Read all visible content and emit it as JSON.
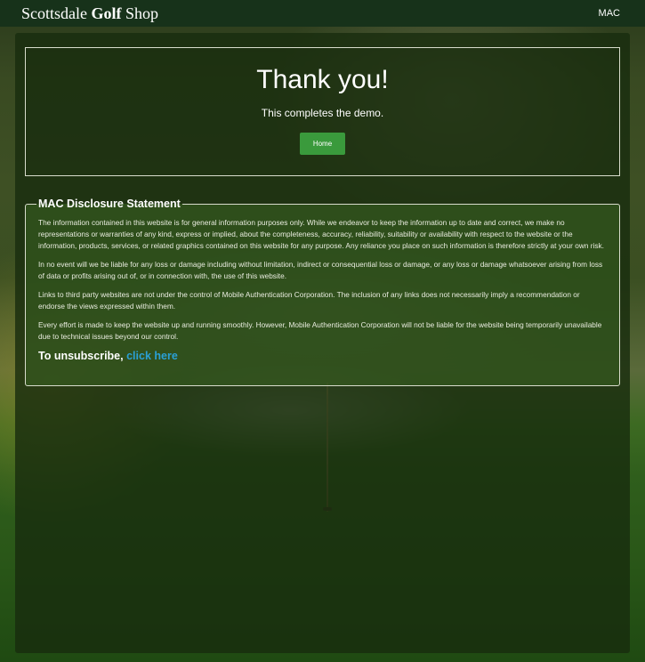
{
  "header": {
    "brand_prefix": "Scottsdale ",
    "brand_strong": "Golf",
    "brand_suffix": " Shop",
    "nav_link": "MAC"
  },
  "thanks": {
    "title": "Thank you!",
    "subtitle": "This completes the demo.",
    "home_button": "Home"
  },
  "disclosure": {
    "legend": "MAC Disclosure Statement",
    "paragraphs": [
      "The information contained in this website is for general information purposes only. While we endeavor to keep the information up to date and correct, we make no representations or warranties of any kind, express or implied, about the completeness, accuracy, reliability, suitability or availability with respect to the website or the information, products, services, or related graphics contained on this website for any purpose. Any reliance you place on such information is therefore strictly at your own risk.",
      "In no event will we be liable for any loss or damage including without limitation, indirect or consequential loss or damage, or any loss or damage whatsoever arising from loss of data or profits arising out of, or in connection with, the use of this website.",
      "Links to third party websites are not under the control of Mobile Authentication Corporation. The inclusion of any links does not necessarily imply a recommendation or endorse the views expressed within them.",
      "Every effort is made to keep the website up and running smoothly. However, Mobile Authentication Corporation will not be liable for the website being temporarily unavailable due to technical issues beyond our control."
    ],
    "unsubscribe_text": "To unsubscribe, ",
    "unsubscribe_link": "click here"
  },
  "colors": {
    "header_bg": "#17321a",
    "button_green": "#3a9a3c",
    "link_blue": "#2aa0d6"
  }
}
